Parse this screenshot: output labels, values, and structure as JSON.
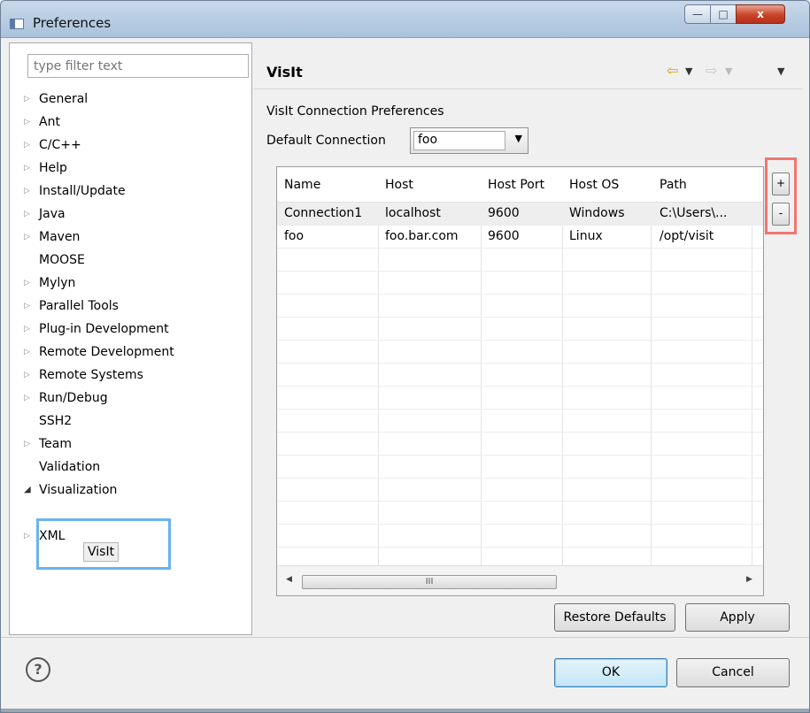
{
  "window": {
    "title": "Preferences",
    "controls": {
      "minimize": "—",
      "maximize": "□",
      "close": "x"
    }
  },
  "sidebar": {
    "filter_placeholder": "type filter text",
    "items": [
      {
        "label": "General",
        "expander": "collapsed"
      },
      {
        "label": "Ant",
        "expander": "collapsed"
      },
      {
        "label": "C/C++",
        "expander": "collapsed"
      },
      {
        "label": "Help",
        "expander": "collapsed"
      },
      {
        "label": "Install/Update",
        "expander": "collapsed"
      },
      {
        "label": "Java",
        "expander": "collapsed"
      },
      {
        "label": "Maven",
        "expander": "collapsed"
      },
      {
        "label": "MOOSE",
        "expander": "none"
      },
      {
        "label": "Mylyn",
        "expander": "collapsed"
      },
      {
        "label": "Parallel Tools",
        "expander": "collapsed"
      },
      {
        "label": "Plug-in Development",
        "expander": "collapsed"
      },
      {
        "label": "Remote Development",
        "expander": "collapsed"
      },
      {
        "label": "Remote Systems",
        "expander": "collapsed"
      },
      {
        "label": "Run/Debug",
        "expander": "collapsed"
      },
      {
        "label": "SSH2",
        "expander": "none"
      },
      {
        "label": "Team",
        "expander": "collapsed"
      },
      {
        "label": "Validation",
        "expander": "none"
      },
      {
        "label": "Visualization",
        "expander": "expanded",
        "children": [
          {
            "label": "VisIt",
            "selected": true
          }
        ]
      },
      {
        "label": "XML",
        "expander": "collapsed"
      }
    ]
  },
  "main": {
    "title": "VisIt",
    "nav_back_icon": "back-arrow-icon",
    "nav_forward_icon": "forward-arrow-icon",
    "section_title": "VisIt Connection Preferences",
    "default_connection_label": "Default Connection",
    "default_connection_value": "foo",
    "table": {
      "columns": [
        "Name",
        "Host",
        "Host Port",
        "Host OS",
        "Path"
      ],
      "rows": [
        [
          "Connection1",
          "localhost",
          "9600",
          "Windows",
          "C:\\Users\\..."
        ],
        [
          "foo",
          "foo.bar.com",
          "9600",
          "Linux",
          "/opt/visit"
        ]
      ],
      "scroll_thumb_grip": "III",
      "scroll_left_arrow": "◀",
      "scroll_right_arrow": "▶"
    },
    "add_button": "+",
    "remove_button": "-",
    "restore_defaults": "Restore Defaults",
    "apply": "Apply"
  },
  "footer": {
    "help_symbol": "?",
    "ok": "OK",
    "cancel": "Cancel"
  },
  "colors": {
    "highlight_tree": "#6ab3ea",
    "highlight_buttons": "#f07672",
    "ok_accent": "#3c7fb1"
  }
}
